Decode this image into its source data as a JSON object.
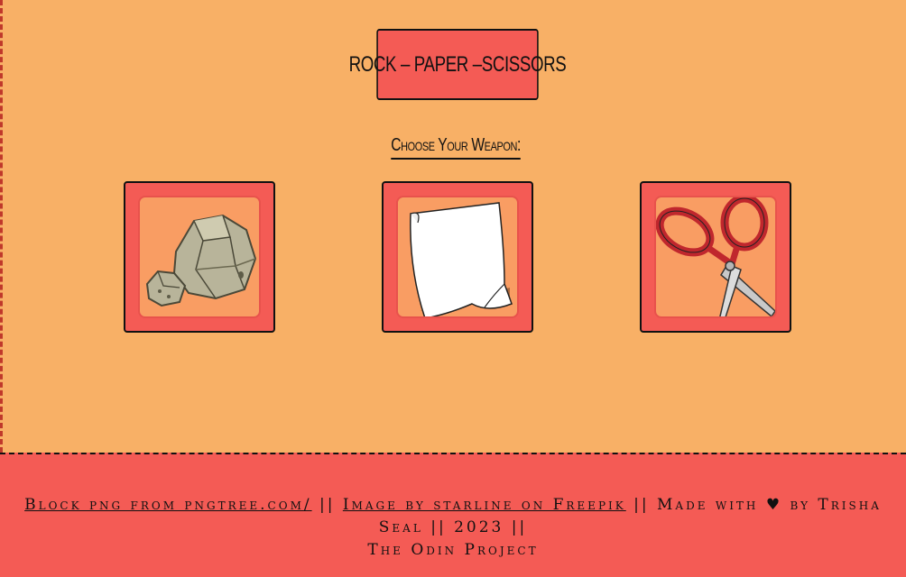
{
  "header": {
    "title": "ROCK – PAPER –SCISSORS",
    "subtitle": "Choose Your Weapon:"
  },
  "weapons": [
    {
      "name": "rock",
      "icon": "rock-icon"
    },
    {
      "name": "paper",
      "icon": "paper-icon"
    },
    {
      "name": "scissors",
      "icon": "scissors-icon"
    }
  ],
  "footer": {
    "link1": "Block png from pngtree.com/",
    "sep1": " || ",
    "link2": "Image by starline on Freepik",
    "sep2": " || Made with ",
    "heart": "♥",
    "credit": " by Trisha Seal || 2023 || ",
    "credit2": "The Odin Project"
  },
  "colors": {
    "background": "#f8b066",
    "accent": "#f45b55",
    "card_inner": "#f99d63"
  }
}
